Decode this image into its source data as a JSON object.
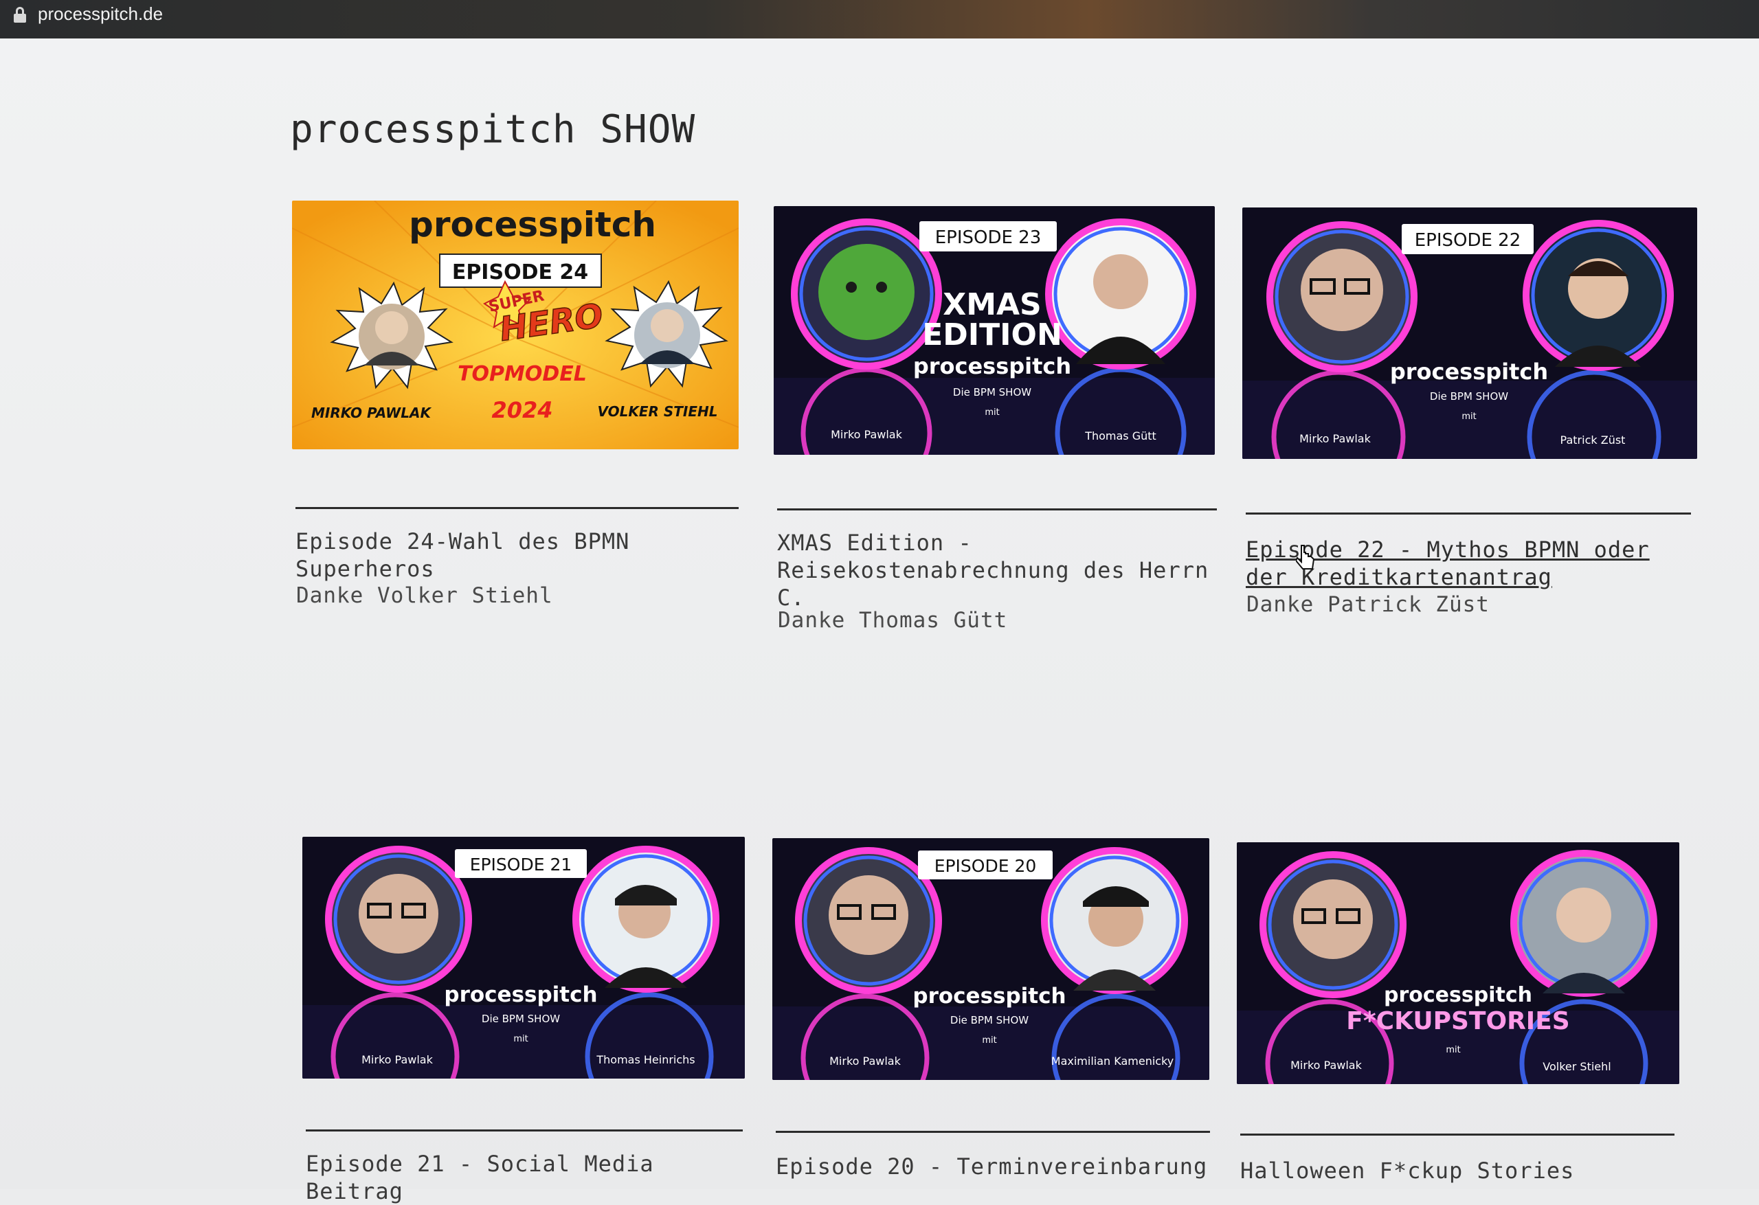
{
  "browser": {
    "url": "processpitch.de"
  },
  "page": {
    "title": "processpitch SHOW"
  },
  "episodes": [
    {
      "title": "Episode 24-Wahl des BPMN Superheros",
      "subtitle": "Danke Volker Stiehl",
      "thumb": {
        "brand": "processpitch",
        "badge": "EPISODE 24",
        "hero_top": "SUPER",
        "hero_main": "HERO",
        "top_model": "TOPMODEL",
        "year": "2024",
        "host": "MIRKO PAWLAK",
        "guest": "VOLKER STIEHL"
      }
    },
    {
      "title": "XMAS Edition - Reisekostenabrechnung des Herrn C.",
      "subtitle": "Danke Thomas Gütt",
      "thumb": {
        "badge": "EPISODE 23",
        "headline1": "XMAS",
        "headline2": "EDITION",
        "brand": "processpitch",
        "show": "Die BPM SHOW",
        "mit": "mit",
        "host": "Mirko Pawlak",
        "guest": "Thomas Gütt"
      }
    },
    {
      "title": "Episode 22 - Mythos BPMN oder der Kreditkartenantrag",
      "subtitle": "Danke Patrick Züst",
      "thumb": {
        "badge": "EPISODE 22",
        "brand": "processpitch",
        "show": "Die BPM SHOW",
        "mit": "mit",
        "host": "Mirko Pawlak",
        "guest": "Patrick Züst"
      }
    },
    {
      "title": "Episode 21 - Social Media Beitrag",
      "subtitle": "",
      "thumb": {
        "badge": "EPISODE 21",
        "brand": "processpitch",
        "show": "Die BPM SHOW",
        "mit": "mit",
        "host": "Mirko Pawlak",
        "guest": "Thomas Heinrichs"
      }
    },
    {
      "title": "Episode 20 - Terminvereinbarung",
      "subtitle": "",
      "thumb": {
        "badge": "EPISODE 20",
        "brand": "processpitch",
        "show": "Die BPM SHOW",
        "mit": "mit",
        "host": "Mirko Pawlak",
        "guest": "Maximilian Kamenicky"
      }
    },
    {
      "title": "Halloween F*ckup Stories",
      "subtitle": "",
      "thumb": {
        "brand": "processpitch",
        "show": "F*CKUPSTORIES",
        "mit": "mit",
        "host": "Mirko Pawlak",
        "guest": "Volker Stiehl"
      }
    }
  ],
  "colors": {
    "neon_pink": "#ff3fd8",
    "neon_blue": "#3f6bff",
    "thumb_dark": "#0e0c1e",
    "comic_yellow": "#f7b21a"
  }
}
